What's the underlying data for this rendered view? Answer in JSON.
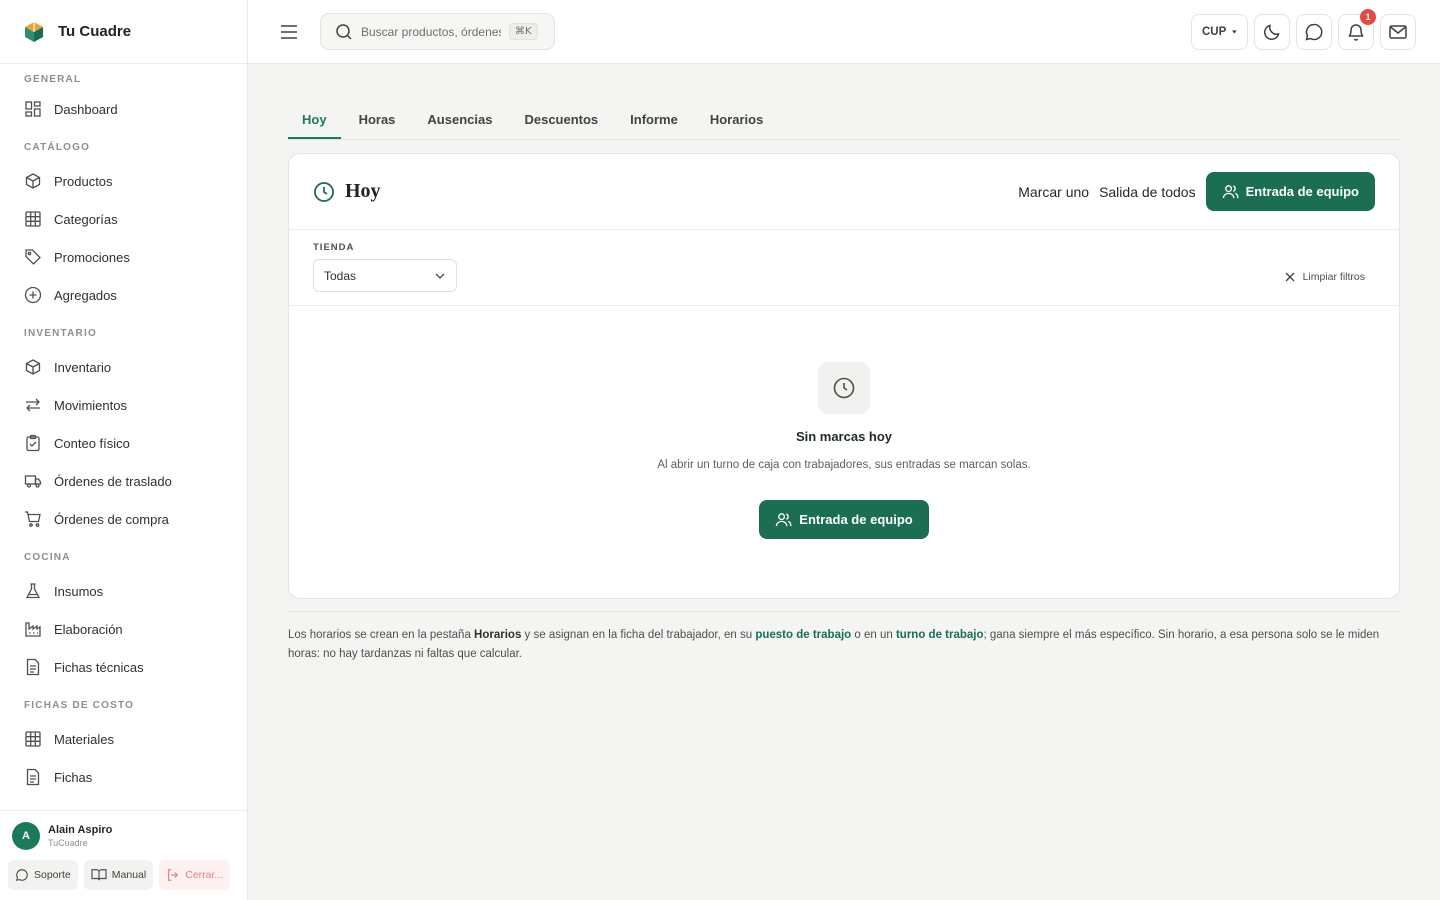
{
  "app": {
    "name": "Tu Cuadre"
  },
  "sidebar": {
    "sections": [
      {
        "label": "GENERAL",
        "items": [
          {
            "label": "Dashboard",
            "icon": "dashboard-icon"
          }
        ]
      },
      {
        "label": "CATÁLOGO",
        "items": [
          {
            "label": "Productos",
            "icon": "box-icon"
          },
          {
            "label": "Categorías",
            "icon": "grid-icon"
          },
          {
            "label": "Promociones",
            "icon": "tag-icon"
          },
          {
            "label": "Agregados",
            "icon": "plus-circle-icon"
          }
        ]
      },
      {
        "label": "INVENTARIO",
        "items": [
          {
            "label": "Inventario",
            "icon": "box-icon"
          },
          {
            "label": "Movimientos",
            "icon": "arrows-icon"
          },
          {
            "label": "Conteo físico",
            "icon": "clipboard-icon"
          },
          {
            "label": "Órdenes de traslado",
            "icon": "truck-icon"
          },
          {
            "label": "Órdenes de compra",
            "icon": "cart-icon"
          }
        ]
      },
      {
        "label": "COCINA",
        "items": [
          {
            "label": "Insumos",
            "icon": "flask-icon"
          },
          {
            "label": "Elaboración",
            "icon": "factory-icon"
          },
          {
            "label": "Fichas técnicas",
            "icon": "document-icon"
          }
        ]
      },
      {
        "label": "FICHAS DE COSTO",
        "items": [
          {
            "label": "Materiales",
            "icon": "grid-icon"
          },
          {
            "label": "Fichas",
            "icon": "document-icon"
          }
        ]
      }
    ],
    "user": {
      "initial": "A",
      "name": "Alain Aspiro",
      "org": "TuCuadre"
    },
    "actions": {
      "support": "Soporte",
      "manual": "Manual",
      "logout": "Cerrar..."
    }
  },
  "topbar": {
    "search_placeholder": "Buscar productos, órdenes...",
    "shortcut": "⌘K",
    "currency": "CUP",
    "notification_count": "1"
  },
  "tabs": [
    "Hoy",
    "Horas",
    "Ausencias",
    "Descuentos",
    "Informe",
    "Horarios"
  ],
  "active_tab": "Hoy",
  "card": {
    "title": "Hoy",
    "mark_one": "Marcar uno",
    "exit_all": "Salida de todos",
    "team_entry": "Entrada de equipo",
    "filter_label": "TIENDA",
    "filter_value": "Todas",
    "clear_filters": "Limpiar filtros",
    "empty_title": "Sin marcas hoy",
    "empty_text": "Al abrir un turno de caja con trabajadores, sus entradas se marcan solas.",
    "empty_button": "Entrada de equipo"
  },
  "note": {
    "p1": "Los horarios se crean en la pestaña ",
    "b1": "Horarios",
    "p2": " y se asignan en la ficha del trabajador, en su ",
    "l1": "puesto de trabajo",
    "p3": " o en un ",
    "l2": "turno de trabajo",
    "p4": "; gana siempre el más específico. Sin horario, a esa persona solo se le miden horas: no hay tardanzas ni faltas que calcular."
  },
  "colors": {
    "accent": "#1b6e52",
    "badge": "#e44848"
  }
}
